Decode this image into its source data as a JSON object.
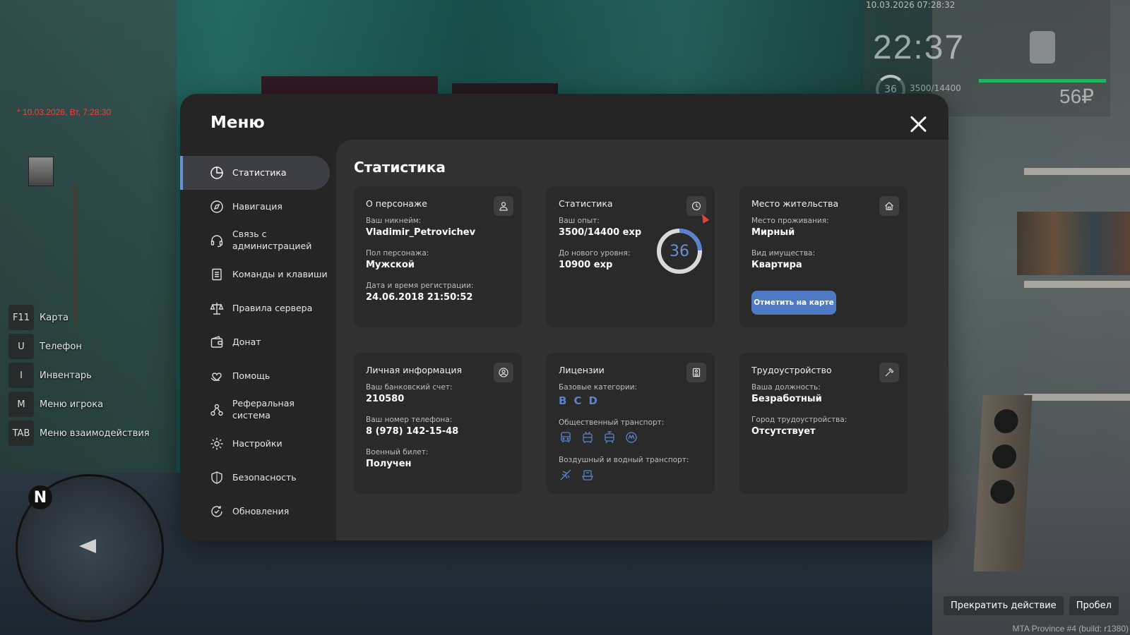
{
  "hud": {
    "date_left": "* 10.03.2026, Вт, 7:28:30",
    "date_top": "10.03.2026 07:28:32",
    "time": "22:37",
    "level": "36",
    "exp": "3500/14400",
    "money": "56₽",
    "keys": [
      {
        "key": "F11",
        "label": "Карта"
      },
      {
        "key": "U",
        "label": "Телефон"
      },
      {
        "key": "I",
        "label": "Инвентарь"
      },
      {
        "key": "M",
        "label": "Меню игрока"
      },
      {
        "key": "TAB",
        "label": "Меню взаимодействия"
      }
    ],
    "radar_north": "N",
    "actions": {
      "stop": "Прекратить действие",
      "key": "Пробел"
    },
    "build": "MTA Province #4 (build: r1380)"
  },
  "menu": {
    "title": "Меню",
    "sidebar": [
      {
        "label": "Статистика",
        "icon": "pie-chart-icon",
        "active": true
      },
      {
        "label": "Навигация",
        "icon": "compass-icon"
      },
      {
        "label": "Связь с администрацией",
        "icon": "headset-icon"
      },
      {
        "label": "Команды и клавиши",
        "icon": "document-list-icon"
      },
      {
        "label": "Правила сервера",
        "icon": "scales-icon"
      },
      {
        "label": "Донат",
        "icon": "wallet-icon"
      },
      {
        "label": "Помощь",
        "icon": "heart-hand-icon"
      },
      {
        "label": "Реферальная система",
        "icon": "referral-icon"
      },
      {
        "label": "Настройки",
        "icon": "gear-icon"
      },
      {
        "label": "Безопасность",
        "icon": "shield-icon"
      },
      {
        "label": "Обновления",
        "icon": "refresh-check-icon"
      }
    ],
    "content_title": "Статистика",
    "cards": {
      "character": {
        "title": "О персонаже",
        "icon": "user-icon",
        "nickname_label": "Ваш никнейм:",
        "nickname": "Vladimir_Petrovichev",
        "gender_label": "Пол персонажа:",
        "gender": "Мужской",
        "reg_label": "Дата и время регистрации:",
        "reg": "24.06.2018 21:50:52"
      },
      "stats": {
        "title": "Статистика",
        "icon": "clock-icon",
        "exp_label": "Ваш опыт:",
        "exp": "3500/14400 exp",
        "next_label": "До нового уровня:",
        "next": "10900 exp",
        "level": "36",
        "level_progress": 0.243
      },
      "residence": {
        "title": "Место жительства",
        "icon": "house-icon",
        "place_label": "Место проживания:",
        "place": "Мирный",
        "type_label": "Вид имущества:",
        "type": "Квартира",
        "button": "Отметить на карте"
      },
      "personal": {
        "title": "Личная информация",
        "icon": "user-circle-icon",
        "bank_label": "Ваш банковский счет:",
        "bank": "210580",
        "phone_label": "Ваш номер телефона:",
        "phone": "8 (978) 142-15-48",
        "military_label": "Военный билет:",
        "military": "Получен"
      },
      "licenses": {
        "title": "Лицензии",
        "icon": "id-card-icon",
        "base_label": "Базовые категории:",
        "base": [
          "B",
          "C",
          "D"
        ],
        "public_label": "Общественный транспорт:",
        "public_icons": [
          "bus-icon",
          "trolleybus-icon",
          "tram-icon",
          "metro-icon"
        ],
        "air_label": "Воздушный и водный транспорт:",
        "air_icons": [
          "plane-icon",
          "boat-icon"
        ]
      },
      "employment": {
        "title": "Трудоустройство",
        "icon": "hammer-icon",
        "position_label": "Ваша должность:",
        "position": "Безработный",
        "city_label": "Город трудоустройства:",
        "city": "Отсутствует"
      }
    }
  },
  "colors": {
    "accent": "#6d8fd0",
    "button": "#4f79c3",
    "panel": "#252525",
    "content": "#323232",
    "card": "#2a2a2a"
  }
}
